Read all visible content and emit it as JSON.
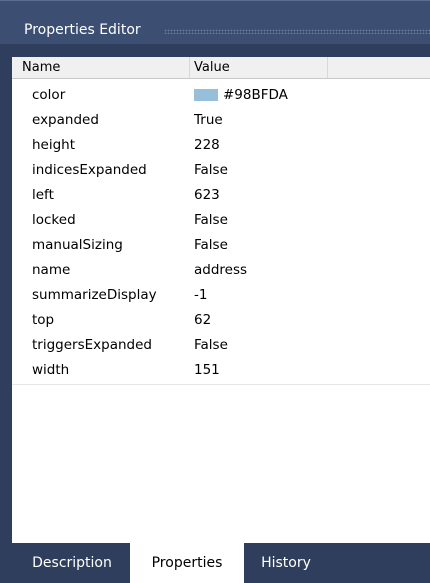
{
  "window": {
    "title": "Properties Editor"
  },
  "grid": {
    "columns": {
      "name": "Name",
      "value": "Value"
    },
    "rows": [
      {
        "name": "color",
        "value": "#98BFDA",
        "swatch": "#98BFDA"
      },
      {
        "name": "expanded",
        "value": "True"
      },
      {
        "name": "height",
        "value": "228"
      },
      {
        "name": "indicesExpanded",
        "value": "False"
      },
      {
        "name": "left",
        "value": "623"
      },
      {
        "name": "locked",
        "value": "False"
      },
      {
        "name": "manualSizing",
        "value": "False"
      },
      {
        "name": "name",
        "value": "address"
      },
      {
        "name": "summarizeDisplay",
        "value": "-1"
      },
      {
        "name": "top",
        "value": "62"
      },
      {
        "name": "triggersExpanded",
        "value": "False"
      },
      {
        "name": "width",
        "value": "151"
      }
    ]
  },
  "tabs": {
    "description": "Description",
    "properties": "Properties",
    "history": "History",
    "active": "Properties"
  }
}
